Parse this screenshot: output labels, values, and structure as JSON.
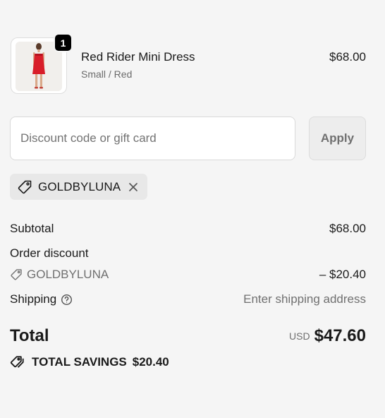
{
  "product": {
    "quantity": "1",
    "name": "Red Rider Mini Dress",
    "variant": "Small / Red",
    "price": "$68.00",
    "image_desc": "red mini dress"
  },
  "discount": {
    "placeholder": "Discount code or gift card",
    "value": "",
    "apply_label": "Apply",
    "applied_code": "GOLDBYLUNA"
  },
  "summary": {
    "subtotal_label": "Subtotal",
    "subtotal_value": "$68.00",
    "order_discount_label": "Order discount",
    "discount_code": "GOLDBYLUNA",
    "discount_value": "– $20.40",
    "shipping_label": "Shipping",
    "shipping_value": "Enter shipping address"
  },
  "total": {
    "label": "Total",
    "currency": "USD",
    "amount": "$47.60"
  },
  "savings": {
    "label": "TOTAL SAVINGS",
    "amount": "$20.40"
  },
  "colors": {
    "background": "#f5f5f5",
    "text": "#1a1a1a",
    "muted": "#707070",
    "badge": "#000000",
    "dress": "#d81e2a"
  }
}
